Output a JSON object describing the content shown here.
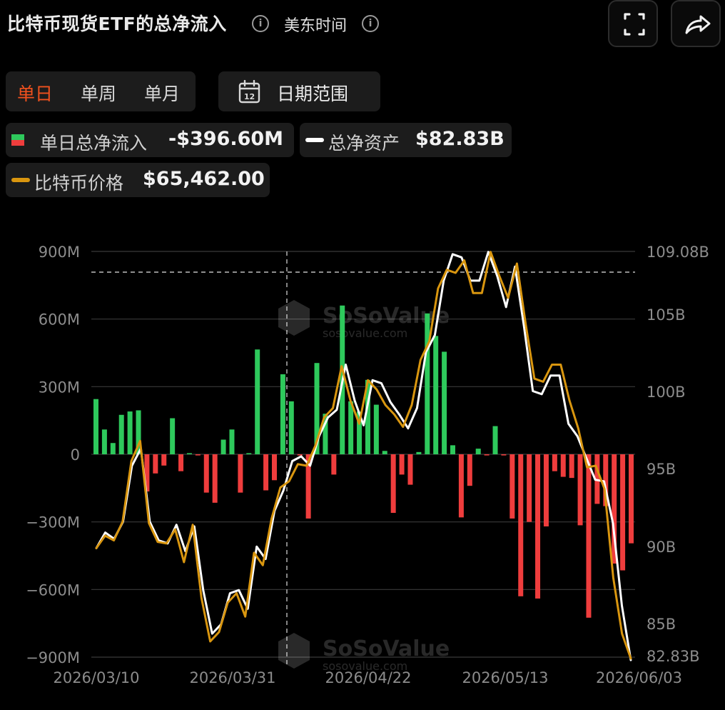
{
  "header": {
    "title": "比特币现货ETF的总净流入",
    "timezone": "美东时间"
  },
  "tabs": {
    "day": "单日",
    "week": "单周",
    "month": "单月",
    "active": "单日"
  },
  "date_range": {
    "label": "日期范围",
    "icon_number": "12"
  },
  "legend": {
    "inflow_label": "单日总净流入",
    "inflow_value": "-$396.60M",
    "assets_label": "总净资产",
    "assets_value": "$82.83B",
    "price_label": "比特币价格",
    "price_value": "$65,462.00"
  },
  "colors": {
    "positive": "#2ec95c",
    "negative": "#ef3d3d",
    "assets_line": "#ffffff",
    "price_line": "#d9960f",
    "active_tab": "#f0511e"
  },
  "watermark": {
    "name": "SoSoValue",
    "domain": "sosovalue.com"
  },
  "chart_data": {
    "type": "bar",
    "left_axis": {
      "ticks": [
        "900M",
        "600M",
        "300M",
        "0",
        "−300M",
        "−600M",
        "−900M"
      ],
      "range": [
        -900,
        900
      ],
      "unit": "M"
    },
    "right_axis": {
      "ticks": [
        "109.08B",
        "105B",
        "100B",
        "95B",
        "90B",
        "85B",
        "82.83B"
      ],
      "range": [
        82.83,
        109.08
      ],
      "unit": "B"
    },
    "x_tick_labels": [
      "2026/03/10",
      "2026/03/31",
      "2026/04/22",
      "2026/05/13",
      "2026/06/03"
    ],
    "grid": true,
    "series": [
      {
        "kind": "bar",
        "values": [
          245,
          110,
          50,
          175,
          190,
          195,
          -165,
          -85,
          -50,
          160,
          -75,
          5,
          -5,
          -170,
          -215,
          65,
          110,
          -170,
          5,
          465,
          -160,
          -115,
          355,
          235,
          -5,
          -285,
          405,
          180,
          -90,
          660,
          235,
          190,
          330,
          220,
          15,
          -260,
          -90,
          -135,
          10,
          625,
          525,
          455,
          40,
          -280,
          -140,
          25,
          -5,
          125,
          -5,
          -285,
          -630,
          -300,
          -640,
          -320,
          -75,
          -100,
          -105,
          -315,
          -725,
          -220,
          -230,
          -485,
          -515,
          -395
        ]
      },
      {
        "kind": "line",
        "values": [
          90.0,
          91.0,
          90.6,
          91.7,
          95.3,
          96.4,
          91.7,
          90.5,
          90.3,
          91.5,
          89.8,
          91.4,
          87.3,
          84.5,
          85.1,
          87.1,
          87.3,
          86.1,
          90.1,
          89.3,
          92.4,
          93.7,
          95.6,
          95.9,
          95.3,
          97.2,
          98.4,
          98.9,
          101.8,
          99.5,
          97.9,
          100.8,
          100.6,
          99.4,
          98.6,
          97.7,
          99.0,
          102.6,
          103.7,
          107.2,
          108.9,
          108.7,
          107.2,
          107.2,
          109.05,
          107.5,
          105.5,
          108.1,
          104.3,
          100.1,
          99.9,
          101.1,
          101.1,
          98.0,
          97.2,
          95.8,
          94.4,
          94.3,
          91.6,
          86.3,
          82.8
        ],
        "x_offset": 0
      },
      {
        "kind": "line",
        "values": [
          90.0,
          90.8,
          90.5,
          91.7,
          95.6,
          96.9,
          91.6,
          90.4,
          90.3,
          91.2,
          89.1,
          91.5,
          86.8,
          84.0,
          84.6,
          86.5,
          87.1,
          85.6,
          89.7,
          88.9,
          91.9,
          93.9,
          94.3,
          95.4,
          95.3,
          96.6,
          98.4,
          99.0,
          101.7,
          99.5,
          98.0,
          100.8,
          100.2,
          99.2,
          98.6,
          97.8,
          99.2,
          102.1,
          103.3,
          106.7,
          107.9,
          107.7,
          108.5,
          106.4,
          106.4,
          109.05,
          107.5,
          106.1,
          108.3,
          104.4,
          100.9,
          100.7,
          101.8,
          101.8,
          99.5,
          97.7,
          95.2,
          95.3,
          93.8,
          88.1,
          84.5,
          82.9
        ],
        "x_offset": 0
      }
    ]
  }
}
